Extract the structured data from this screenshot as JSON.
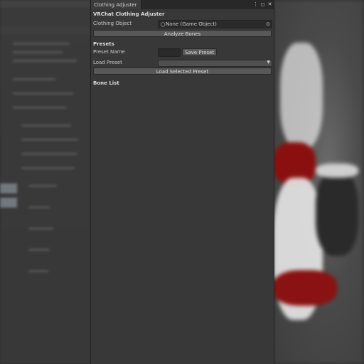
{
  "window": {
    "tab_title": "Clothing Adjuster",
    "tab_controls": {
      "menu_icon": "kebab-menu-icon",
      "maximize_icon": "maximize-icon",
      "close_icon": "close-icon"
    }
  },
  "inspector": {
    "title": "VRChat Clothing Adjuster",
    "clothing_object": {
      "label": "Clothing Object",
      "value": "None (Game Object)",
      "icon": "game-object-icon",
      "picker_icon": "object-picker-icon"
    },
    "analyze_button": "Analyze Bones",
    "presets": {
      "heading": "Presets",
      "preset_name_label": "Preset Name",
      "preset_name_value": "",
      "save_button": "Save Preset",
      "load_label": "Load Preset",
      "load_selected": "",
      "load_button": "Load Selected Preset"
    },
    "bone_list_heading": "Bone List"
  },
  "colors": {
    "window_bg": "#383838",
    "tab_bar_bg": "#282828",
    "button_bg": "#585858",
    "field_bg": "#2a2a2a"
  }
}
